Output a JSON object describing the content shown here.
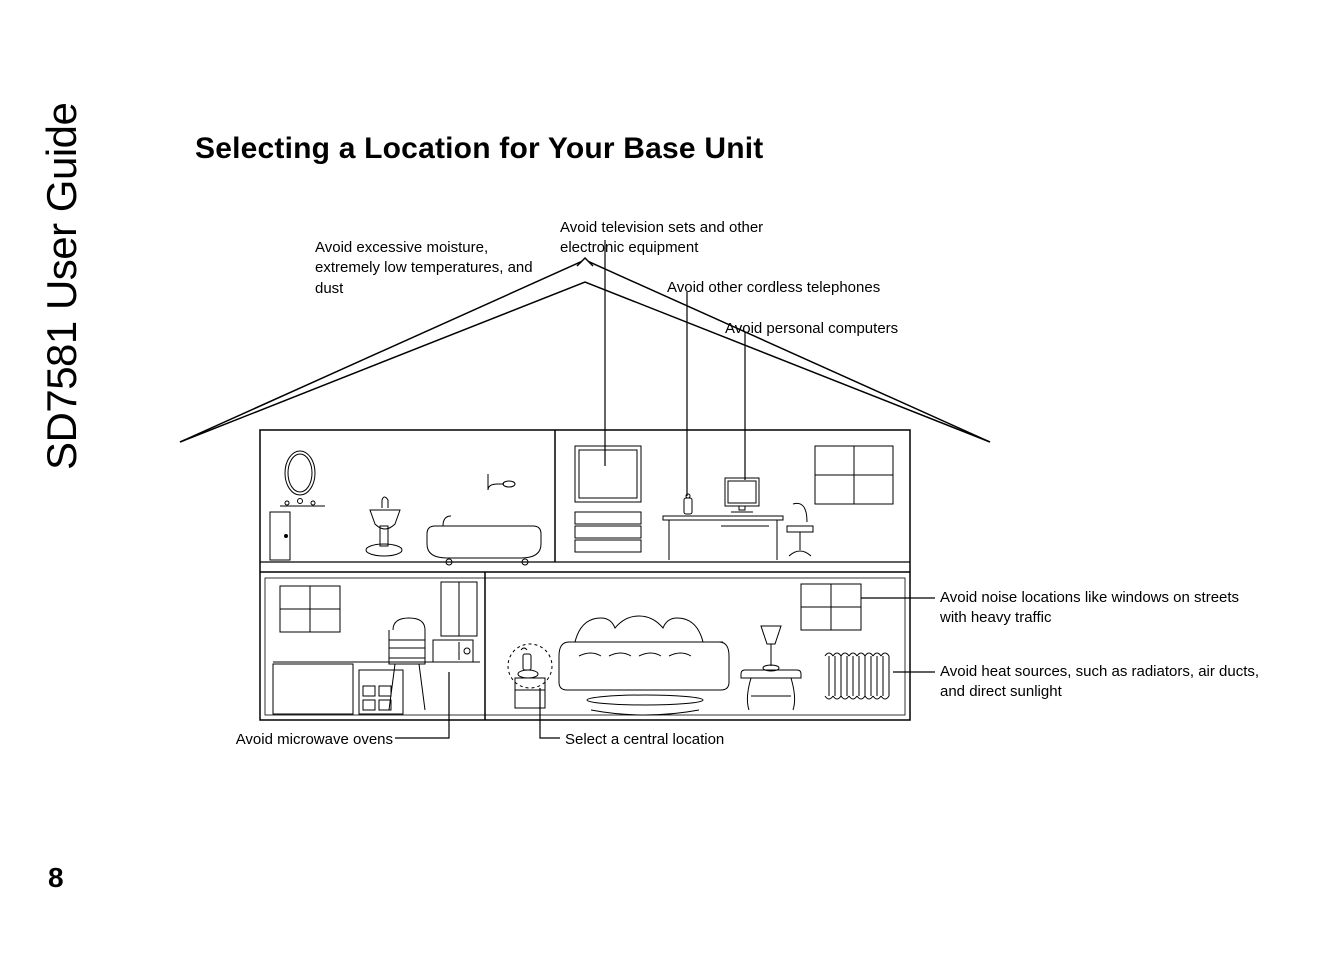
{
  "side_title": "SD7581 User Guide",
  "page_number": "8",
  "heading": "Selecting a Location for Your Base Unit",
  "callouts": {
    "moisture": "Avoid excessive moisture, extremely low temperatures, and dust",
    "tv": "Avoid television sets and other electronic equipment",
    "cordless": "Avoid other cordless telephones",
    "pc": "Avoid personal computers",
    "noise": "Avoid noise locations like windows on streets with heavy traffic",
    "heat": "Avoid heat sources, such as radiators, air ducts, and direct sunlight",
    "microwave": "Avoid microwave ovens",
    "central": "Select a central location"
  }
}
